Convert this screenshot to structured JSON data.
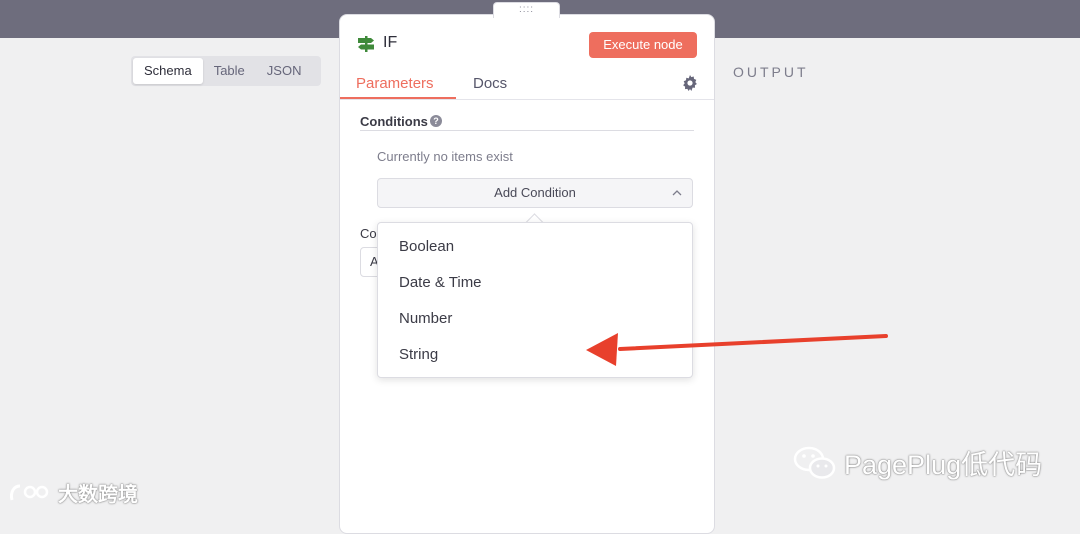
{
  "view_tabs": [
    "Schema",
    "Table",
    "JSON"
  ],
  "output_label": "OUTPUT",
  "node": {
    "drag_handle": "::::",
    "title": "IF",
    "execute_label": "Execute node",
    "tabs": [
      "Parameters",
      "Docs"
    ],
    "conditions_label": "Conditions",
    "empty_text": "Currently no items exist",
    "add_condition_label": "Add Condition",
    "combine_label_partial": "Co",
    "combine_value_partial": "A"
  },
  "dropdown": {
    "options": [
      "Boolean",
      "Date & Time",
      "Number",
      "String"
    ]
  },
  "watermarks": {
    "left": "大数跨境",
    "right": "PagePlug低代码"
  },
  "colors": {
    "accent": "#ee6e5e",
    "topbar": "#6e6d7d",
    "arrow": "#e8402c"
  }
}
